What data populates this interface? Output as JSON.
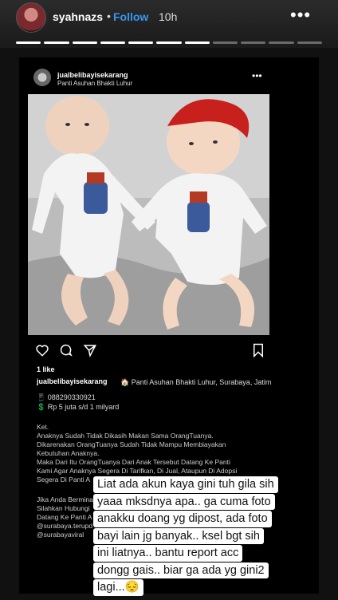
{
  "story": {
    "username": "syahnazs",
    "separator": "•",
    "follow_label": "Follow",
    "time": "10h",
    "more_label": "•••",
    "segments_total": 11,
    "segments_done": 7
  },
  "post": {
    "username": "jualbelibayisekarang",
    "location": "Panti Asuhan Bhakti Luhur",
    "more_label": "•••",
    "likes": "1 like",
    "caption_user": "jualbelibayisekarang",
    "caption_location": "🏠 Panti Asuhan Bhakti Luhur, Surabaya, Jatim",
    "phone": "📱 088290330921",
    "price": "💲 Rp 5 juta s/d 1 milyard",
    "ket_lines": [
      "Ket.",
      "Anaknya Sudah Tidak Dikasih Makan Sama OrangTuanya.",
      "Dikarenakan OrangTuanya Sudah Tidak Mampu Membiayakan",
      "Kebutuhan Anaknya.",
      "Maka Dari Itu OrangTuanya Dari Anak Tersebut Datang Ke Panti",
      "Kami Agar Anaknya Segera Di Tarifkan, Di Jual, Ataupun Di Adopsi",
      "Segera Di Panti A"
    ],
    "contact_lines": [
      "Jika Anda Bermina",
      "Silahkan Hubungi",
      "Datang Ke Panti A",
      "@surabaya.terupd",
      "@surabayaviral"
    ]
  },
  "overlay_lines": [
    "Liat ada akun kaya gini tuh gila sih",
    "yaaa mksdnya apa.. ga cuma foto",
    "anakku doang yg dipost, ada foto",
    "bayi lain jg banyak.. ksel bgt sih",
    "ini  liatnya.. bantu report acc",
    "dongg gais.. biar ga ada yg gini2",
    "lagi...😔"
  ],
  "colors": {
    "follow": "#3897f0",
    "background": "#111111",
    "bow": "#c8201c"
  }
}
